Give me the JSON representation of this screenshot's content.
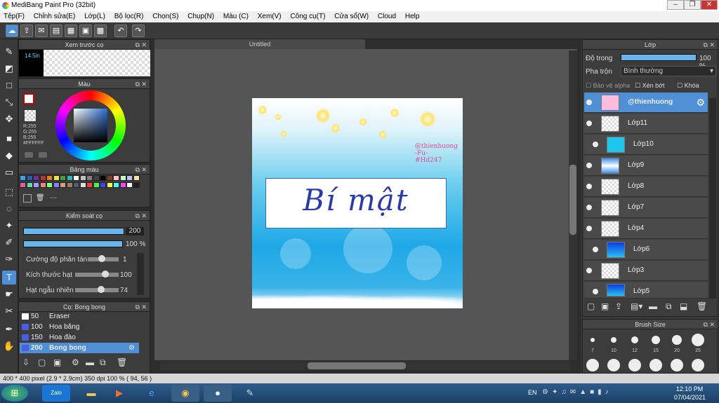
{
  "app": {
    "title": "MediBang Paint Pro (32bit)"
  },
  "menu": [
    "Tệp(F)",
    "Chỉnh sửa(E)",
    "Lớp(L)",
    "Bộ lọc(R)",
    "Chọn(S)",
    "Chụp(N)",
    "Màu (C)",
    "Xem(V)",
    "Công cụ(T)",
    "Cửa sổ(W)",
    "Cloud",
    "Help"
  ],
  "preview": {
    "title": "Xem trước cọ",
    "size_label": "14.5in"
  },
  "color": {
    "title": "Màu",
    "r": "R:255",
    "g": "G:255",
    "b": "B:255",
    "hex": "#FFFFFF"
  },
  "palette": {
    "title": "Bảng màu",
    "colors": [
      "#3aa0e8",
      "#2060c0",
      "#7030a0",
      "#c03030",
      "#e08020",
      "#f0e040",
      "#40a040",
      "#20c0c0",
      "#ffffff",
      "#c0c0c0",
      "#808080",
      "#404040",
      "#000000",
      "#804020",
      "#ffc0c0",
      "#c0ffc0",
      "#c0c0ff",
      "#ffe0a0",
      "#e060a0",
      "#60e0a0",
      "#a0a0ff",
      "#ff8080",
      "#80ff80",
      "#8080ff",
      "#d0a080",
      "#a08060",
      "#506070",
      "#e0e0e0",
      "#ff4040",
      "#40ff40",
      "#4040ff",
      "#ffff40",
      "#40ffff",
      "#ff40ff",
      "#ffffff",
      "#202020"
    ],
    "more_label": "---"
  },
  "brushctl": {
    "title": "Kiểm soát cọ",
    "size_value": "200",
    "opacity_value": "100 %",
    "scatter_label": "Cường độ phân tán",
    "scatter_value": "1",
    "grain_label": "Kích thước hạt",
    "grain_value": "100",
    "random_label": "Hạt ngẫu nhiên",
    "random_value": "74",
    "size_pct": 1.0,
    "opacity_pct": 1.0,
    "scatter_pct": 0.45,
    "grain_pct": 0.7,
    "random_pct": 0.6
  },
  "brushes": {
    "title": "Cọ: Bong bong",
    "items": [
      {
        "size": "50",
        "name": "Eraser"
      },
      {
        "size": "100",
        "name": "Hoa băng"
      },
      {
        "size": "150",
        "name": "Hoa đào"
      },
      {
        "size": "200",
        "name": "Bong bong"
      }
    ]
  },
  "document": {
    "tab": "Untitled"
  },
  "artwork": {
    "title": "Bí mật",
    "watermark": [
      "@thienhuong",
      "-Fu-",
      "#Hd247"
    ]
  },
  "status": {
    "text": "400 * 400 pixel   (2.9 * 2.9cm)   350 dpi   100 %   ( 94, 56 )"
  },
  "layers": {
    "title": "Lớp",
    "opacity_label": "Độ trong",
    "opacity_value": "100 %",
    "opacity_pct": 1.0,
    "blend_label": "Pha trộn",
    "blend_value": "Bình thường",
    "protect_alpha": "Bảo vệ alpha",
    "clip": "Xén bớt",
    "lock": "Khóa",
    "items": [
      {
        "name": "@thienhuong",
        "sel": true,
        "child": false
      },
      {
        "name": "Lớp11",
        "child": false
      },
      {
        "name": "Lớp10",
        "child": true
      },
      {
        "name": "Lớp9",
        "child": false
      },
      {
        "name": "Lớp8",
        "child": false
      },
      {
        "name": "Lớp7",
        "child": false
      },
      {
        "name": "Lớp4",
        "child": false
      },
      {
        "name": "Lớp6",
        "child": true
      },
      {
        "name": "Lớp3",
        "child": false
      },
      {
        "name": "Lớp5",
        "child": true
      }
    ]
  },
  "brushsize": {
    "title": "Brush Size",
    "sizes": [
      "7",
      "10",
      "12",
      "15",
      "20",
      "25"
    ]
  },
  "taskbar": {
    "lang": "EN",
    "time": "12:10 PM",
    "date": "07/04/2021"
  },
  "colors": {
    "accent": "#4f8fd6",
    "panel": "#3a3a3a"
  }
}
